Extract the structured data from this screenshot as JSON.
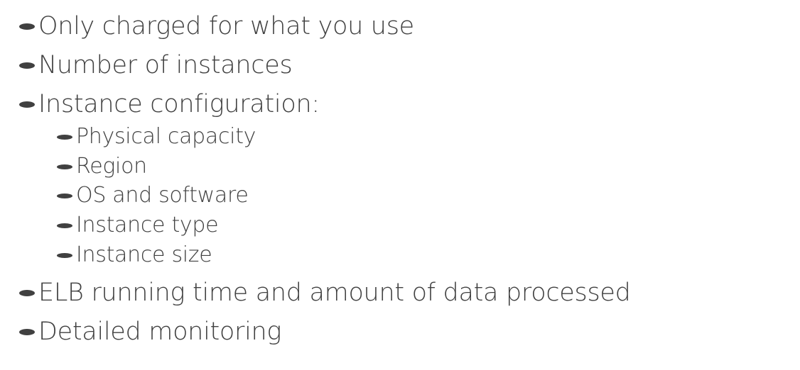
{
  "bullets": {
    "b1": "Only charged for what you use",
    "b2": "Number of instances",
    "b3": "Instance configuration:",
    "b3_sub": {
      "s1": "Physical capacity",
      "s2": "Region",
      "s3": "OS and software",
      "s4": "Instance type",
      "s5": "Instance size"
    },
    "b4": "ELB running time and amount of data processed",
    "b5": "Detailed monitoring"
  }
}
